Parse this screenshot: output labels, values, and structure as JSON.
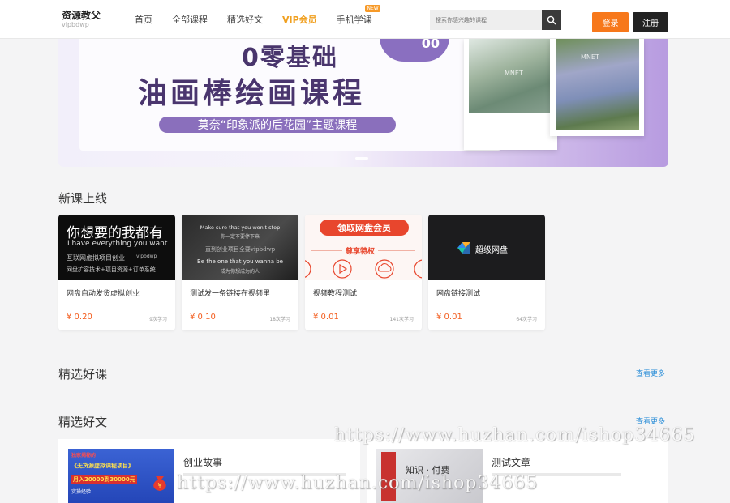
{
  "header": {
    "logo_main": "资源教父",
    "logo_sub": "vipbdwp",
    "nav": [
      {
        "label": "首页"
      },
      {
        "label": "全部课程"
      },
      {
        "label": "精选好文"
      },
      {
        "label": "VIP会员"
      },
      {
        "label": "手机学课",
        "badge": "NEW"
      }
    ],
    "search_placeholder": "搜索你感兴趣的课程",
    "login_label": "登录",
    "register_label": "注册"
  },
  "banner": {
    "line1": "0零基础",
    "line2": "油画棒绘画课程",
    "subtitle": "莫奈“印象派的后花园”主题课程",
    "bubble": "00",
    "painting1_caption": "MNET",
    "painting2_caption": "MNET"
  },
  "new_courses": {
    "title": "新课上线",
    "items": [
      {
        "title": "网盘自动发货虚拟创业",
        "price": "¥ 0.20",
        "learners": "9次学习",
        "thumb": {
          "line1": "你想要的我都有",
          "line2": "I have everything you want",
          "line3": "互联网虚拟项目创业",
          "line3b": "vipbdwp",
          "line4": "网盘扩容技术+项目资源+订单系统"
        }
      },
      {
        "title": "测试发一条链接在视频里",
        "price": "¥ 0.10",
        "learners": "18次学习",
        "thumb": {
          "line1": "Make sure that you won't stop",
          "line2": "你一定不要停下来",
          "line3": "直到创业项目全要vipbdwp",
          "line4": "Be the one that you wanna be",
          "line5": "成为你想成为的人"
        }
      },
      {
        "title": "视频教程测试",
        "price": "¥ 0.01",
        "learners": "141次学习",
        "thumb": {
          "button": "领取网盘会员",
          "label": "尊享特权"
        }
      },
      {
        "title": "网盘链接测试",
        "price": "¥ 0.01",
        "learners": "64次学习",
        "thumb": {
          "text": "超级网盘"
        }
      }
    ]
  },
  "featured_courses": {
    "title": "精选好课",
    "more": "查看更多"
  },
  "featured_articles": {
    "title": "精选好文",
    "more": "查看更多",
    "items": [
      {
        "title": "创业故事",
        "thumb_l1": "独家揭秘的",
        "thumb_l2": "《无货源虚拟课程项目》",
        "thumb_l3": "月入20000到30000元",
        "thumb_l4": "实操经验"
      },
      {
        "title": "测试文章",
        "thumb_text": "知识 · 付费"
      }
    ]
  },
  "watermark": "https://www.huzhan.com/ishop34665"
}
